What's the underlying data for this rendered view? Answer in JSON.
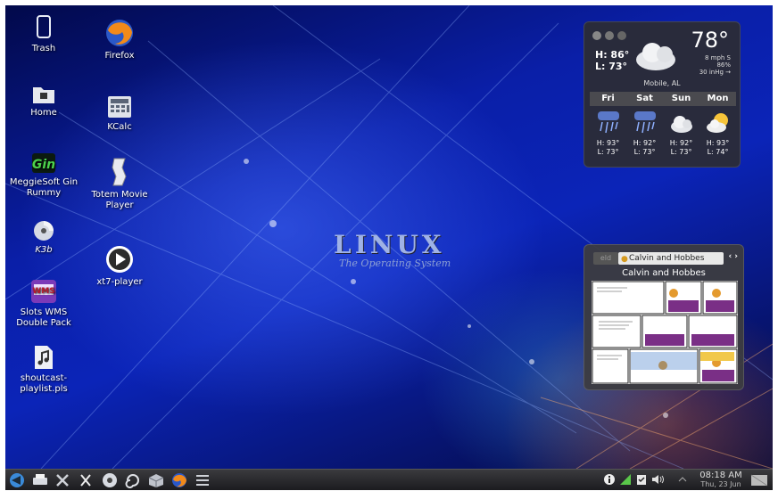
{
  "desktop_icons": [
    {
      "label": "Trash",
      "icon": "trash-icon"
    },
    {
      "label": "Home",
      "icon": "folder-home-icon"
    },
    {
      "label": "MeggieSoft Gin Rummy",
      "icon": "gin-rummy-icon"
    },
    {
      "label": "K3b",
      "icon": "k3b-disc-icon"
    },
    {
      "label": "Slots WMS Double Pack",
      "icon": "slots-icon"
    },
    {
      "label": "shoutcast-playlist.pls",
      "icon": "audio-file-icon"
    },
    {
      "label": "Firefox",
      "icon": "firefox-icon"
    },
    {
      "label": "KCalc",
      "icon": "calculator-icon"
    },
    {
      "label": "Totem Movie Player",
      "icon": "totem-film-icon"
    },
    {
      "label": "xt7-player",
      "icon": "play-icon"
    }
  ],
  "wallpaper": {
    "title": "LINUX",
    "subtitle": "The Operating System"
  },
  "weather": {
    "high": "H: 86°",
    "low": "L: 73°",
    "temp": "78°",
    "wind": "8 mph S",
    "humidity": "86%",
    "pressure": "30 inHg →",
    "location": "Mobile, AL",
    "forecast": [
      {
        "day": "Fri",
        "icon": "thunderstorm-icon",
        "high": "H: 93°",
        "low": "L: 73°"
      },
      {
        "day": "Sat",
        "icon": "thunderstorm-icon",
        "high": "H: 92°",
        "low": "L: 73°"
      },
      {
        "day": "Sun",
        "icon": "cloudy-icon",
        "high": "H: 92°",
        "low": "L: 73°"
      },
      {
        "day": "Mon",
        "icon": "partly-sunny-icon",
        "high": "H: 93°",
        "low": "L: 74°"
      }
    ]
  },
  "comic": {
    "prev_tab": "eld",
    "active_tab": "Calvin and Hobbes",
    "title": "Calvin and Hobbes",
    "nav": "‹ ›"
  },
  "taskbar": {
    "launchers": [
      "kde-menu-icon",
      "printer-icon",
      "tools-icon",
      "settings-icon",
      "disc-icon",
      "swirl-icon",
      "package-icon",
      "firefox-icon",
      "list-icon"
    ],
    "tray": [
      "info-icon",
      "network-icon",
      "clipboard-icon",
      "volume-icon",
      "chevron-up-icon"
    ],
    "time": "08:18 AM",
    "date": "Thu, 23 Jun"
  },
  "colors": {
    "panel": "#2a2a2e",
    "widget_bg": "#2d2d32",
    "accent_blue": "#0b24b8"
  }
}
